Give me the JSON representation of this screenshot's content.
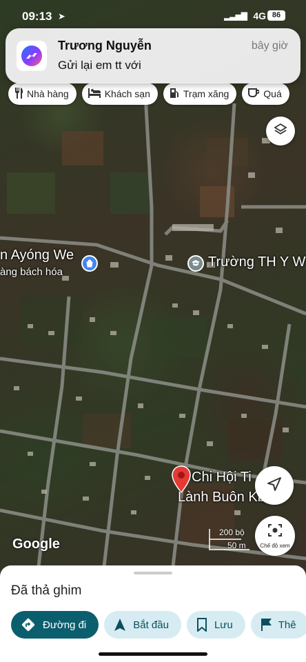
{
  "status_bar": {
    "time": "09:13",
    "network": "4G",
    "battery": "86"
  },
  "notification": {
    "sender": "Trương Nguyễn",
    "time": "bây giờ",
    "message": "Gửi lại em tt với",
    "app_icon": "messenger-icon"
  },
  "categories": [
    {
      "label": "Nhà hàng",
      "icon": "restaurant-icon"
    },
    {
      "label": "Khách sạn",
      "icon": "hotel-icon"
    },
    {
      "label": "Trạm xăng",
      "icon": "gas-station-icon"
    },
    {
      "label": "Quá",
      "icon": "coffee-icon"
    }
  ],
  "map": {
    "labels": {
      "place1_name": "n Ayóng We",
      "place1_sub": "àng bách hóa",
      "school": "Trường TH Y W",
      "pin_line1": "Chi Hội Ti",
      "pin_line2": "Lành Buôn Kbu"
    },
    "attribution": "Google",
    "scale_ft": "200 bộ",
    "scale_m": "50 m",
    "street_view_label": "Chế độ xem"
  },
  "sheet": {
    "title": "Đã thả ghim",
    "actions": [
      {
        "label": "Đường đi",
        "icon": "directions-icon"
      },
      {
        "label": "Bắt đầu",
        "icon": "navigation-icon"
      },
      {
        "label": "Lưu",
        "icon": "bookmark-icon"
      },
      {
        "label": "Thê",
        "icon": "flag-icon"
      }
    ]
  },
  "colors": {
    "primary_action": "#0b5e6e",
    "secondary_action": "#d6ecf2",
    "marker": "#e53935"
  }
}
